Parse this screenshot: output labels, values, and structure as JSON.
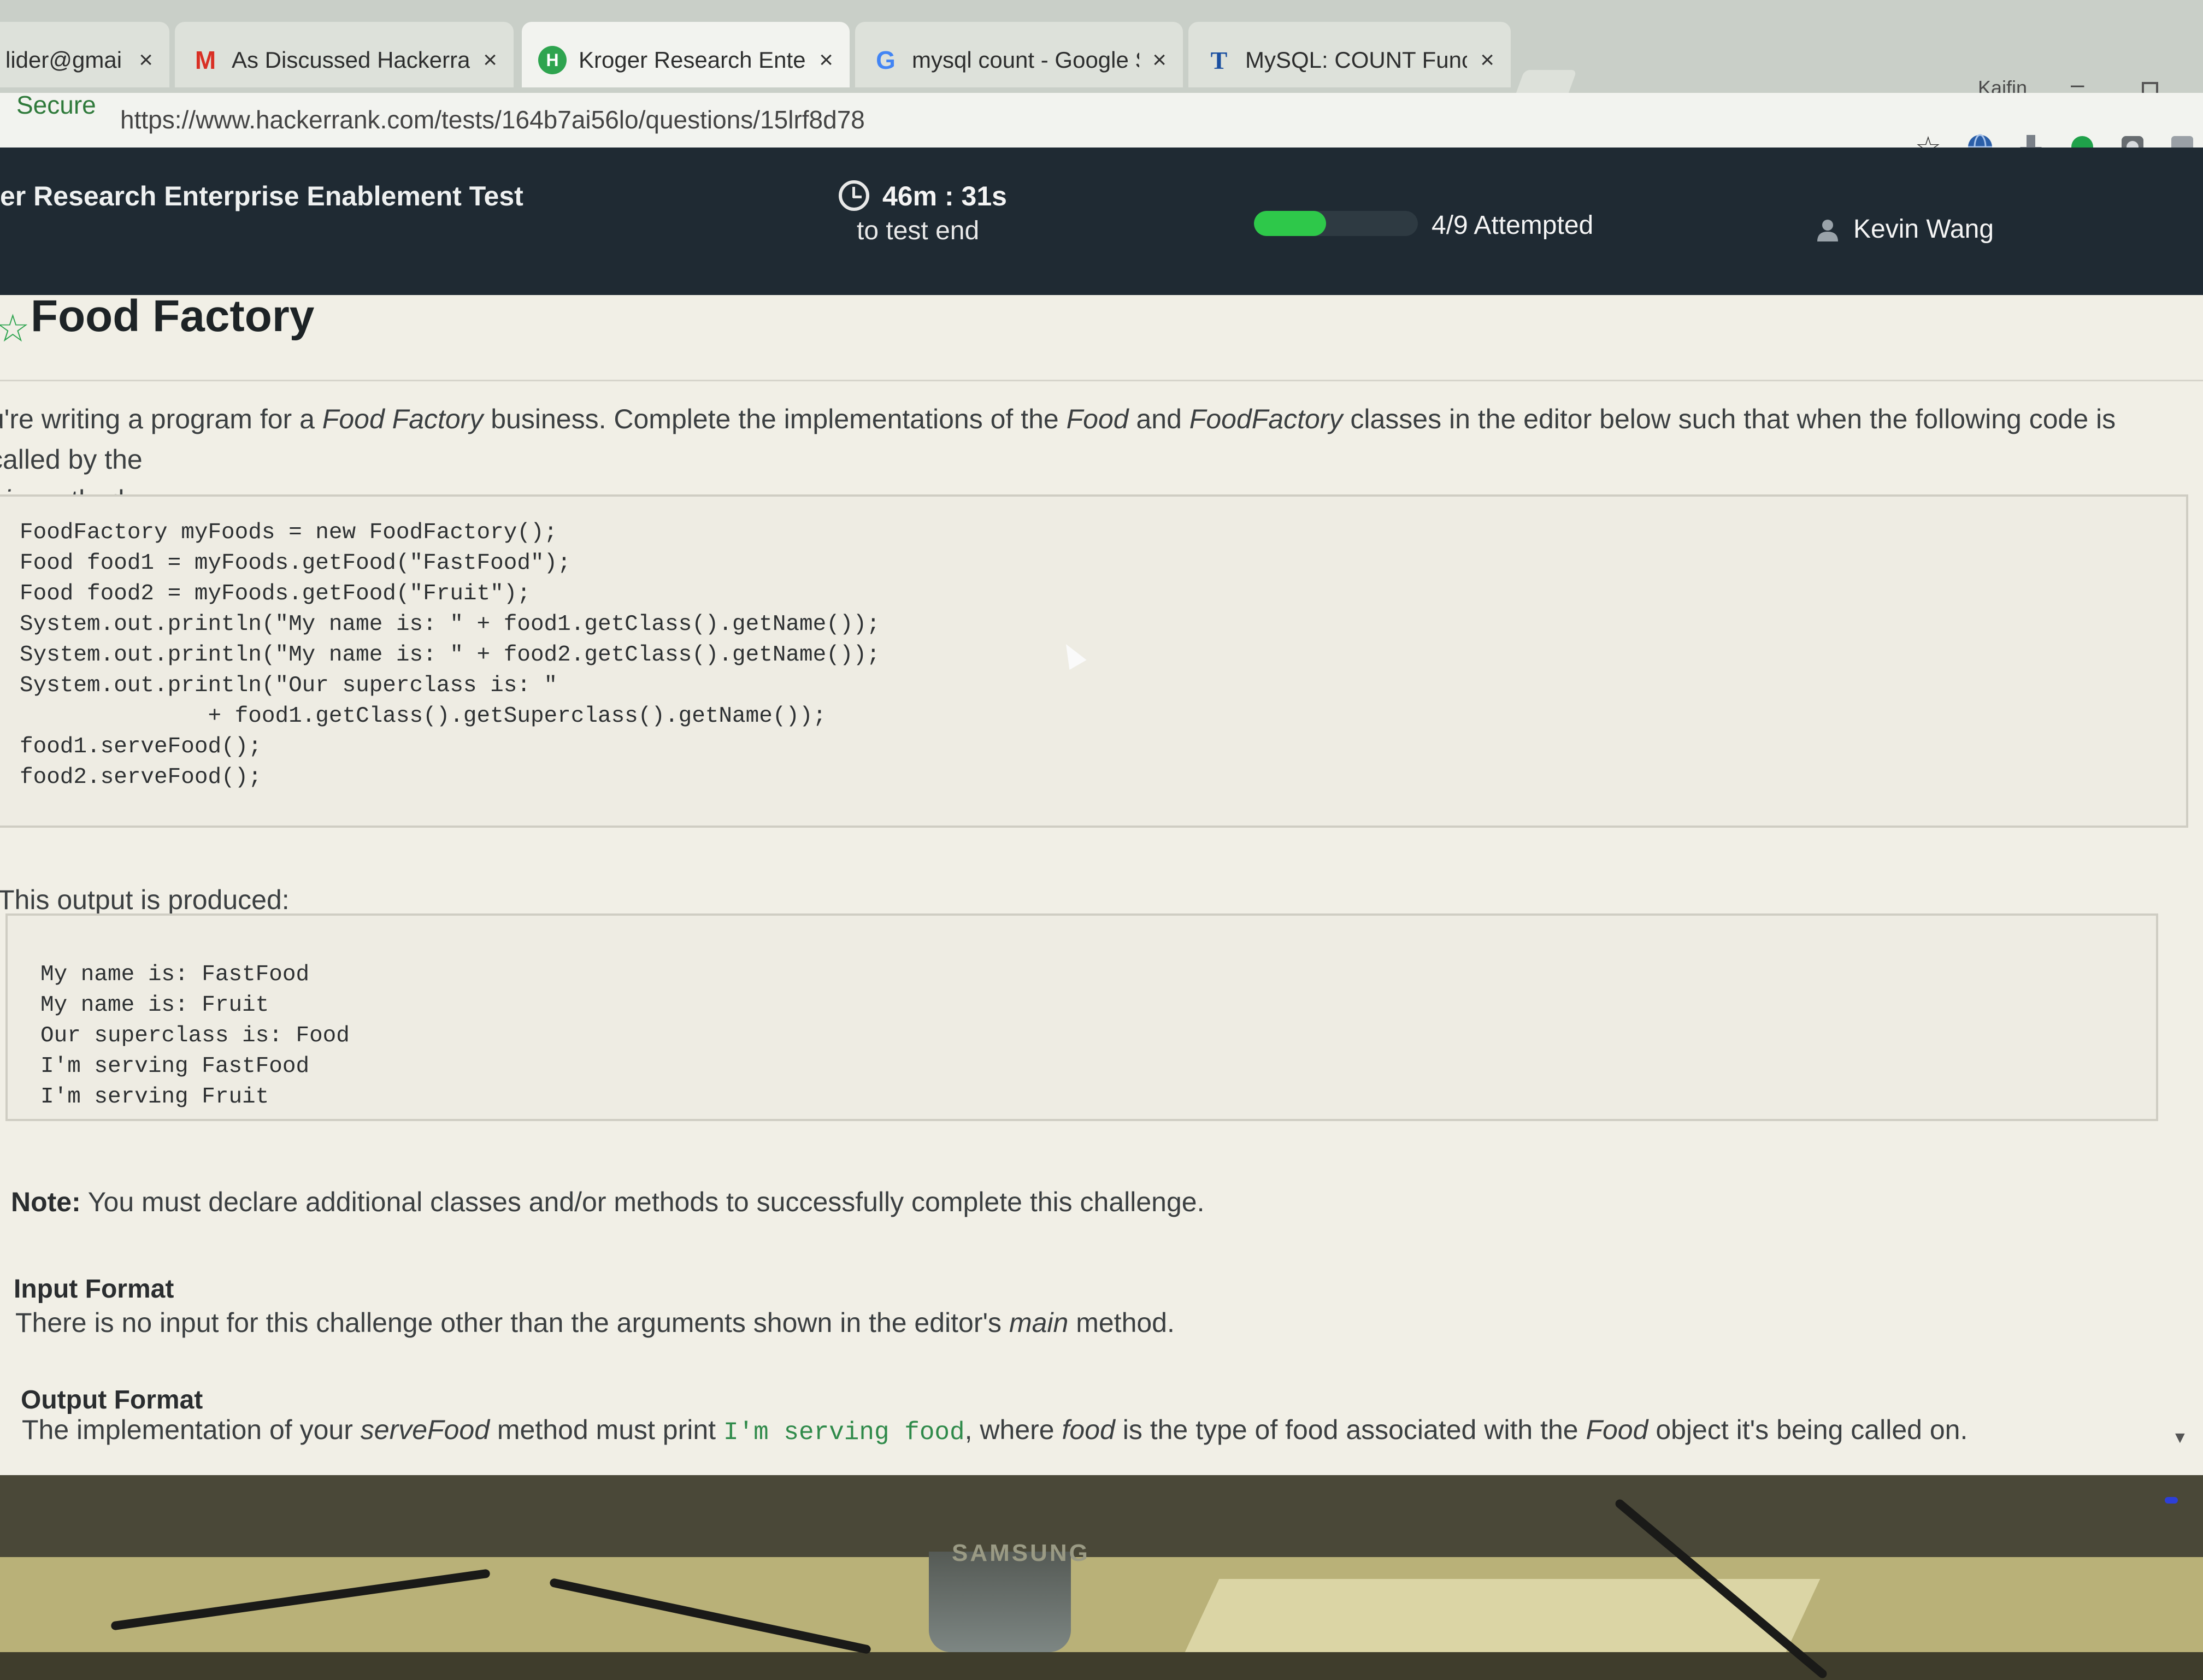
{
  "browser": {
    "tabs": [
      {
        "title": "lider@gmai",
        "favicon": "email-icon",
        "close": "×",
        "active": false
      },
      {
        "title": "As Discussed Hackerrank",
        "favicon": "gmail-icon",
        "fav_glyph": "M",
        "close": "×",
        "active": false
      },
      {
        "title": "Kroger Research Enterpri",
        "favicon": "hackerrank-icon",
        "fav_glyph": "H",
        "close": "×",
        "active": true
      },
      {
        "title": "mysql count - Google Se",
        "favicon": "google-icon",
        "fav_glyph": "G",
        "close": "×",
        "active": false
      },
      {
        "title": "MySQL: COUNT Function",
        "favicon": "techonthenet-icon",
        "fav_glyph": "T",
        "close": "×",
        "active": false
      }
    ],
    "profile_name": "Kaifin",
    "window_minimize": "–",
    "secure_label": "Secure",
    "url": "https://www.hackerrank.com/tests/164b7ai56lo/questions/15lrf8d78",
    "toolbar_icons": [
      "star-icon",
      "globe-icon",
      "download-icon",
      "green-circle-icon",
      "extension-icon",
      "extension-icon-2"
    ]
  },
  "header": {
    "test_title": "er Research Enterprise Enablement Test",
    "timer_value": "46m : 31s",
    "timer_sub": "to test end",
    "progress_fraction": 0.44,
    "attempted": "4/9 Attempted",
    "user_name": "Kevin Wang",
    "progress_color": "#2ec84a"
  },
  "question": {
    "title": "Food Factory",
    "intro_1": "u're writing a program for a ",
    "intro_em_1": "Food Factory",
    "intro_2": " business. Complete the implementations of the ",
    "intro_em_2": "Food",
    "intro_3": " and ",
    "intro_em_3": "FoodFactory",
    "intro_4": " classes in the editor below such that when the following code is called by the",
    "intro_em_5": "ain",
    "intro_5": " method:",
    "code_lines": [
      "FoodFactory myFoods = new FoodFactory();",
      "Food food1 = myFoods.getFood(\"FastFood\");",
      "Food food2 = myFoods.getFood(\"Fruit\");",
      "System.out.println(\"My name is: \" + food1.getClass().getName());",
      "System.out.println(\"My name is: \" + food2.getClass().getName());",
      "System.out.println(\"Our superclass is: \"",
      "              + food1.getClass().getSuperclass().getName());",
      "food1.serveFood();",
      "food2.serveFood();"
    ],
    "output_label": "This output is produced:",
    "output_lines": [
      "My name is: FastFood",
      "My name is: Fruit",
      "Our superclass is: Food",
      "I'm serving FastFood",
      "I'm serving Fruit"
    ],
    "note_label": "Note:",
    "note_text": " You must declare additional classes and/or methods to successfully complete this challenge.",
    "input_heading": "Input Format",
    "input_1": "There is no input for this challenge other than the arguments shown in the editor's ",
    "input_em": "main",
    "input_2": " method.",
    "output_heading": "Output Format",
    "out_1": "The implementation of your ",
    "out_em_1": "serveFood",
    "out_2": " method must print ",
    "out_code": "I'm serving food",
    "out_3": ", where ",
    "out_em_2": "food",
    "out_4": " is the type of food associated with the ",
    "out_em_3": "Food",
    "out_5": " object it's being called on."
  },
  "monitor": {
    "brand": "SAMSUNG"
  }
}
